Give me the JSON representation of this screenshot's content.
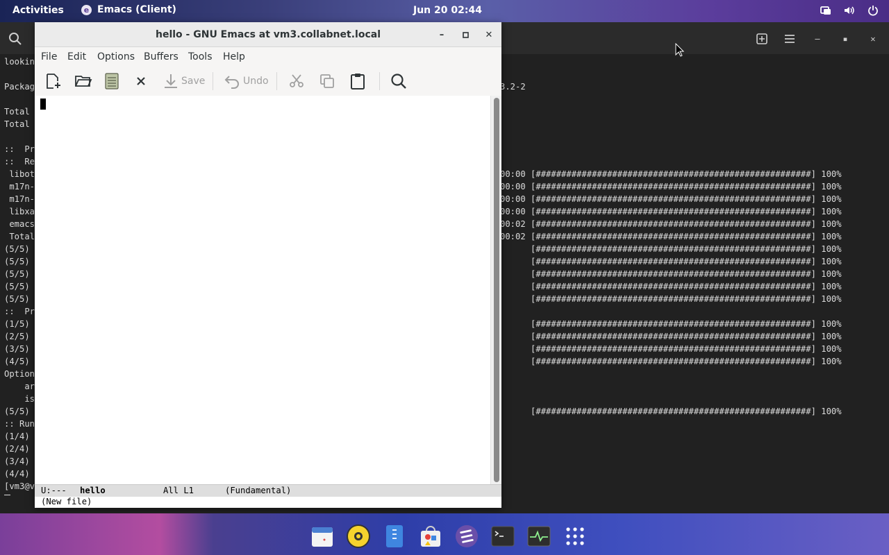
{
  "topbar": {
    "activities": "Activities",
    "app_name": "Emacs (Client)",
    "clock": "Jun 20  02:44"
  },
  "terminal": {
    "left_lines": [
      "lookin",
      "",
      "Packag",
      "",
      "Total",
      "Total",
      "",
      "::  Pro",
      "::  Ret",
      " libot",
      " m17n-",
      " m17n-",
      " libxa",
      " emacs",
      " Total",
      "(5/5)",
      "(5/5)",
      "(5/5)",
      "(5/5)",
      "(5/5)",
      "::  Pro",
      "(1/5)",
      "(2/5)",
      "(3/5)",
      "(4/5)",
      "Option",
      "    ar",
      "    is",
      "(5/5)",
      ":: Run",
      "(1/4)",
      "(2/4)",
      "(3/4)",
      "(4/4)",
      "[vm3@v"
    ],
    "right_lines": [
      "",
      "",
      "3.2-2",
      "",
      "",
      "",
      "",
      "",
      "",
      "00:00 [######################################################] 100%",
      "00:00 [######################################################] 100%",
      "00:00 [######################################################] 100%",
      "00:00 [######################################################] 100%",
      "00:02 [######################################################] 100%",
      "00:02 [######################################################] 100%",
      "      [######################################################] 100%",
      "      [######################################################] 100%",
      "      [######################################################] 100%",
      "      [######################################################] 100%",
      "      [######################################################] 100%",
      "",
      "      [######################################################] 100%",
      "      [######################################################] 100%",
      "      [######################################################] 100%",
      "      [######################################################] 100%",
      "",
      "",
      "",
      "      [######################################################] 100%"
    ]
  },
  "emacs": {
    "title": "hello - GNU Emacs at vm3.collabnet.local",
    "menu": [
      "File",
      "Edit",
      "Options",
      "Buffers",
      "Tools",
      "Help"
    ],
    "toolbar": {
      "save": "Save",
      "undo": "Undo"
    },
    "modeline": {
      "status": "U:---",
      "buffer": "hello",
      "position": "All L1",
      "mode": "(Fundamental)"
    },
    "echo": "(New file)"
  },
  "icons": {
    "search": "search-icon",
    "new_file": "new-file-icon",
    "open": "open-folder-icon",
    "dired": "dired-icon",
    "close": "close-icon",
    "save": "save-icon",
    "undo": "undo-icon",
    "cut": "cut-icon",
    "copy": "copy-icon",
    "paste": "paste-icon"
  },
  "colors": {
    "accent": "#5b3f98",
    "terminal_bg": "#212121"
  }
}
